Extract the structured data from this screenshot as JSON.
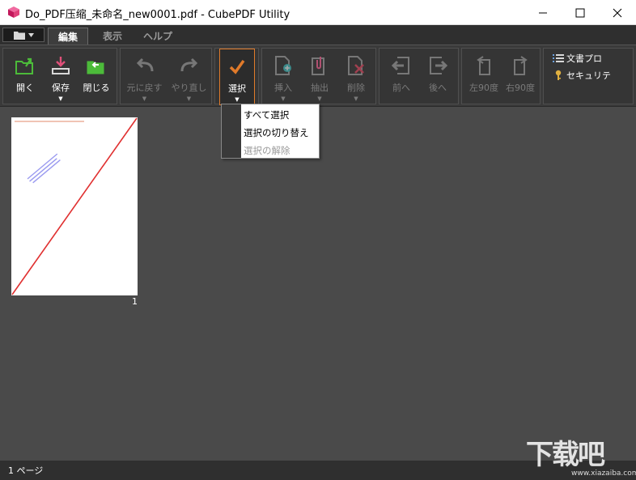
{
  "window": {
    "title": "Do_PDF压缩_未命名_new0001.pdf - CubePDF Utility"
  },
  "tabs": [
    {
      "label": "編集",
      "active": true
    },
    {
      "label": "表示",
      "active": false
    },
    {
      "label": "ヘルプ",
      "active": false
    }
  ],
  "ribbon": {
    "open": "開く",
    "save": "保存",
    "close": "閉じる",
    "undo": "元に戻す",
    "redo": "やり直し",
    "select": "選択",
    "insert": "挿入",
    "extract": "抽出",
    "delete": "削除",
    "previous": "前へ",
    "next": "後へ",
    "rotate_left": "左90度",
    "rotate_right": "右90度",
    "properties": "文書プロ",
    "security": "セキュリテ"
  },
  "select_menu": {
    "items": [
      {
        "label": "すべて選択",
        "enabled": true
      },
      {
        "label": "選択の切り替え",
        "enabled": true
      },
      {
        "label": "選択の解除",
        "enabled": false
      }
    ]
  },
  "thumbnail": {
    "page_number": "1"
  },
  "status": {
    "pages": "1 ページ"
  },
  "watermark": {
    "text": "下载吧",
    "sub": "www.xiazaiba.com"
  },
  "colors": {
    "accent": "#e07a2a",
    "green_icon": "#4cbb3a",
    "pink_icon": "#e0507a"
  }
}
